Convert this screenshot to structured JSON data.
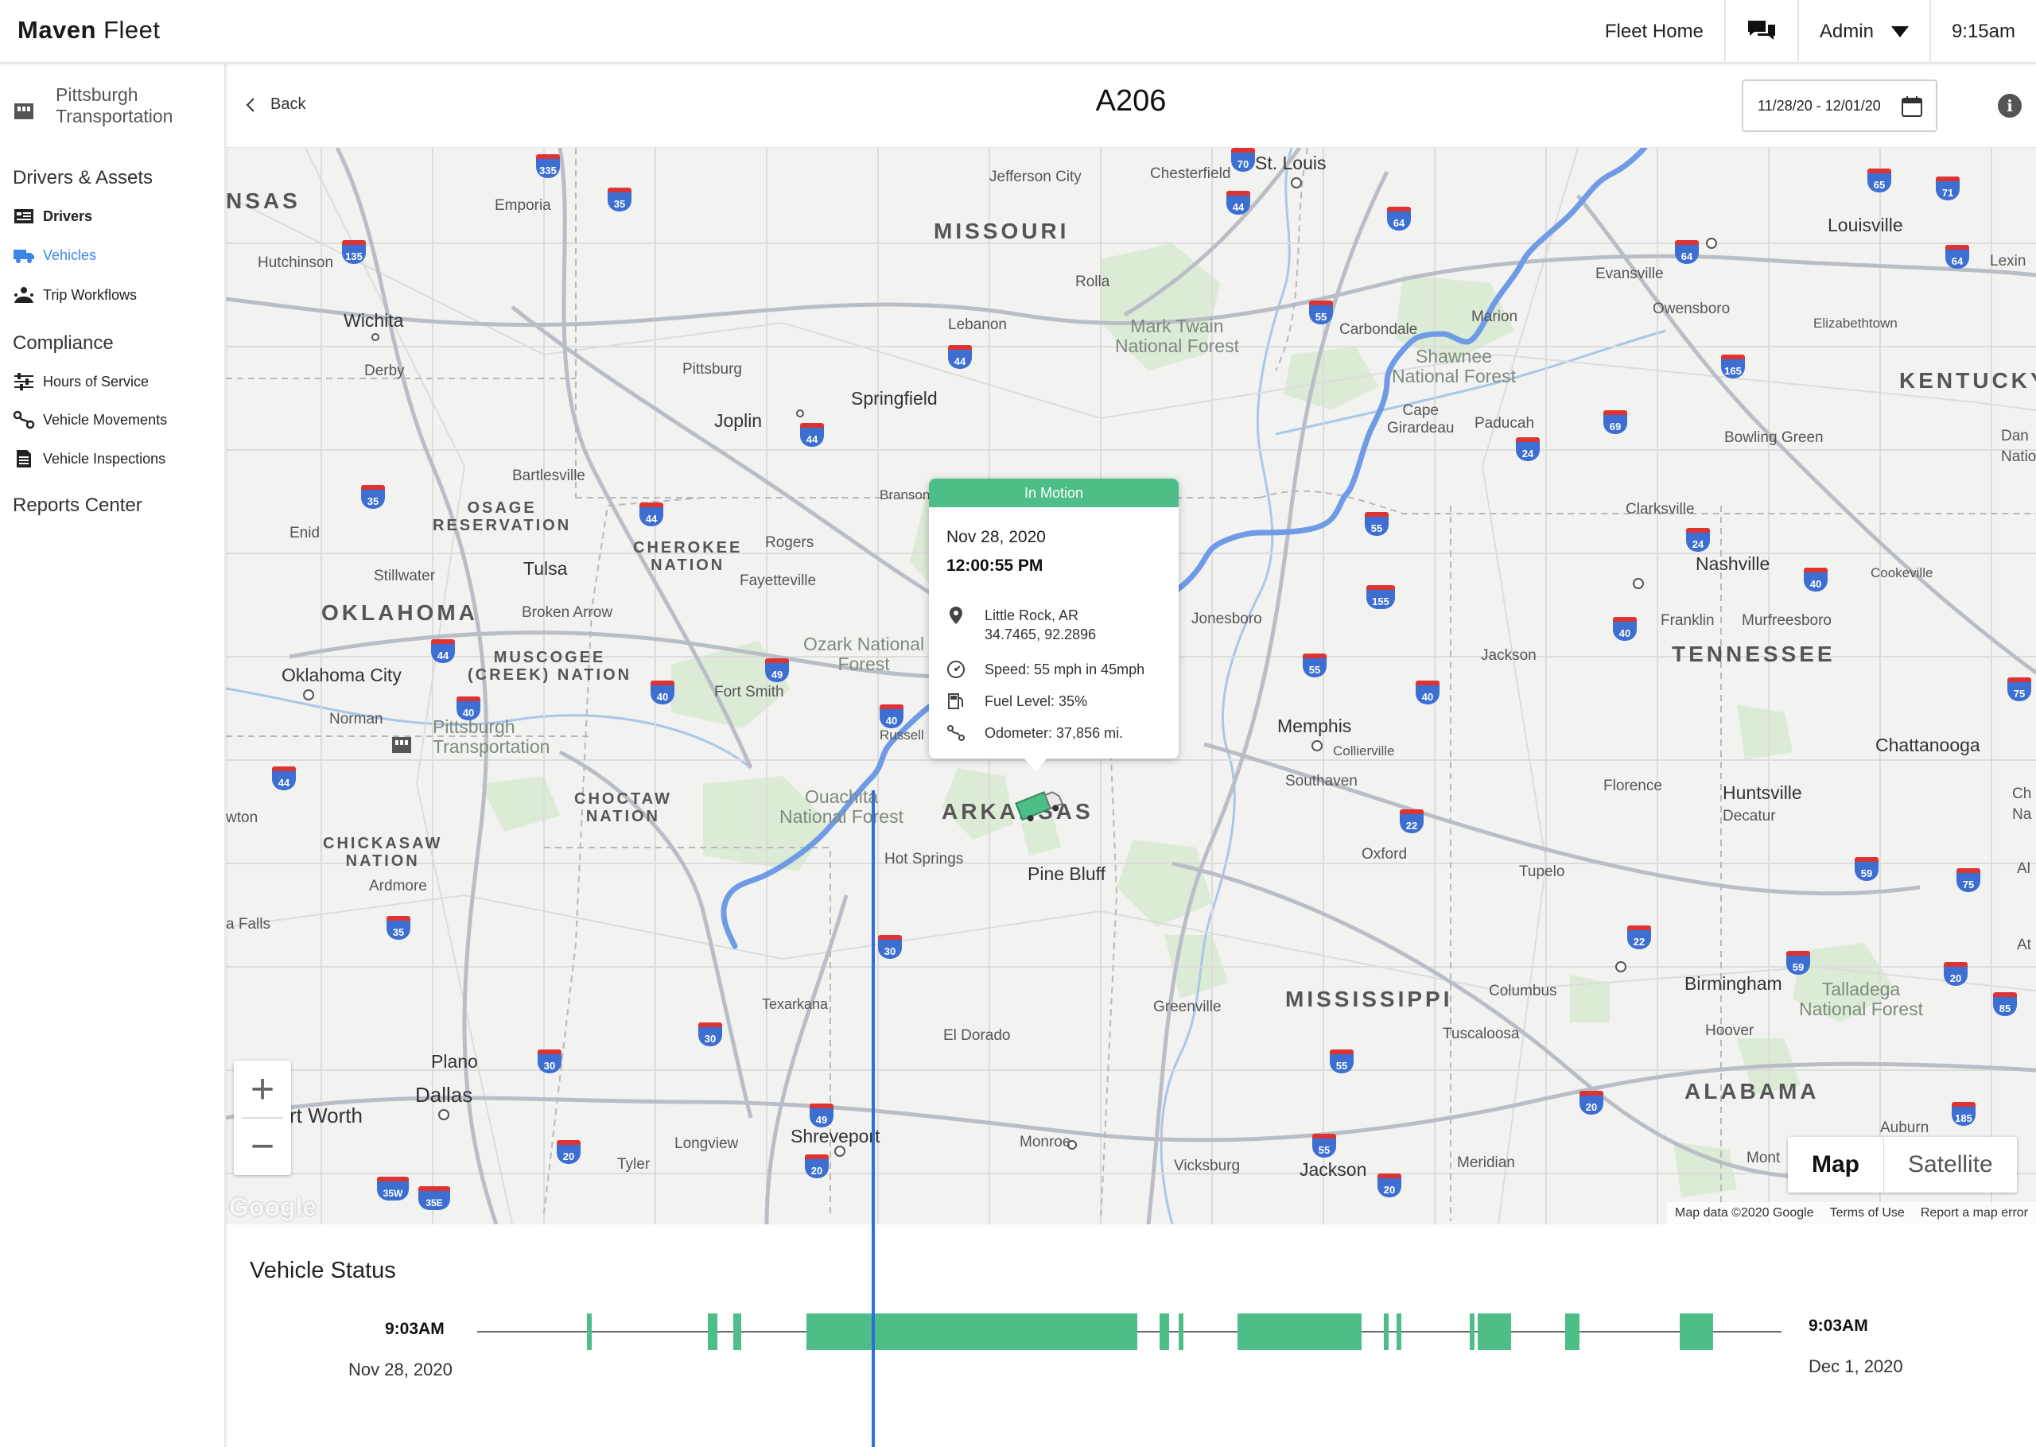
{
  "topbar": {
    "logo_bold": "Maven",
    "logo_rest": "Fleet",
    "fleet_home": "Fleet Home",
    "admin": "Admin",
    "time": "9:15am"
  },
  "sidebar": {
    "org_line1": "Pittsburgh",
    "org_line2": "Transportation",
    "sections": {
      "drivers_assets": "Drivers & Assets",
      "compliance": "Compliance",
      "reports": "Reports Center"
    },
    "items": [
      {
        "label": "Drivers"
      },
      {
        "label": "Vehicles"
      },
      {
        "label": "Trip Workflows"
      },
      {
        "label": "Hours of Service"
      },
      {
        "label": "Vehicle Movements"
      },
      {
        "label": "Vehicle Inspections"
      }
    ],
    "active_color": "#3d86e6"
  },
  "header": {
    "back": "Back",
    "title": "A206",
    "date_range": "11/28/20 - 12/01/20"
  },
  "map": {
    "labels": {
      "st_louis": "St. Louis",
      "jefferson_city": "Jefferson City",
      "chesterfield": "Chesterfield",
      "missouri": "MISSOURI",
      "rolla": "Rolla",
      "louisville": "Louisville",
      "evansville": "Evansville",
      "owensboro": "Owensboro",
      "elizabethtown": "Elizabethtown",
      "lexington": "Lexin",
      "kentucky": "KENTUCKY",
      "nsas": "NSAS",
      "emporia": "Emporia",
      "hutchinson": "Hutchinson",
      "wichita": "Wichita",
      "derby": "Derby",
      "lebanon": "Lebanon",
      "pittsburg": "Pittsburg",
      "springfield": "Springfield",
      "joplin": "Joplin",
      "mark_twain_1": "Mark Twain",
      "mark_twain_2": "National Forest",
      "carbondale": "Carbondale",
      "marion": "Marion",
      "shawnee_1": "Shawnee",
      "shawnee_2": "National Forest",
      "cape_1": "Cape",
      "cape_2": "Girardeau",
      "paducah": "Paducah",
      "bowling_green": "Bowling Green",
      "dan": "Dan",
      "natio": "Natio",
      "bartlesville": "Bartlesville",
      "osage_1": "OSAGE",
      "osage_2": "RESERVATION",
      "enid": "Enid",
      "cherokee_1": "CHEROKEE",
      "cherokee_2": "NATION",
      "rogers": "Rogers",
      "branson": "Branson",
      "clarksville": "Clarksville",
      "stillwater": "Stillwater",
      "tulsa": "Tulsa",
      "fayetteville": "Fayetteville",
      "nashville": "Nashville",
      "cookeville": "Cookeville",
      "oklahoma": "OKLAHOMA",
      "broken_arrow": "Broken Arrow",
      "ozark_1": "Ozark National",
      "ozark_2": "Forest",
      "jonesboro": "Jonesboro",
      "franklin": "Franklin",
      "murfreesboro": "Murfreesboro",
      "muscogee_1": "MUSCOGEE",
      "muscogee_2": "(CREEK) NATION",
      "oklahoma_city": "Oklahoma City",
      "fort_smith": "Fort Smith",
      "jackson_tn": "Jackson",
      "tennessee": "TENNESSEE",
      "norman": "Norman",
      "pitt_1": "Pittsburgh",
      "pitt_2": "Transportation",
      "russellville": "Russell",
      "memphis": "Memphis",
      "collierville": "Collierville",
      "chattanooga": "Chattanooga",
      "southaven": "Southaven",
      "lawton": "wton",
      "choctaw_1": "CHOCTAW",
      "choctaw_2": "NATION",
      "ouachita_1": "Ouachita",
      "ouachita_2": "National Forest",
      "arkansas": "ARKANSAS",
      "florence": "Florence",
      "huntsville": "Huntsville",
      "decatur": "Decatur",
      "ch": "Ch",
      "na": "Na",
      "chickasaw_1": "CHICKASAW",
      "chickasaw_2": "NATION",
      "hot_springs": "Hot Springs",
      "pine_bluff": "Pine Bluff",
      "oxford": "Oxford",
      "tupelo": "Tupelo",
      "ardmore": "Ardmore",
      "al": "Al",
      "falls": "a Falls",
      "at": "At",
      "texarkana": "Texarkana",
      "greenville": "Greenville",
      "mississippi": "MISSISSIPPI",
      "columbus": "Columbus",
      "birmingham": "Birmingham",
      "talladega_1": "Talladega",
      "talladega_2": "National Forest",
      "el_dorado": "El Dorado",
      "tuscaloosa": "Tuscaloosa",
      "hoover": "Hoover",
      "plano": "Plano",
      "dallas": "Dallas",
      "fort_worth": "rt Worth",
      "alabama": "ALABAMA",
      "longview": "Longview",
      "shreveport": "Shreveport",
      "monroe": "Monroe",
      "auburn": "Auburn",
      "tyler": "Tyler",
      "vicksburg": "Vicksburg",
      "jackson_ms": "Jackson",
      "meridian": "Meridian",
      "mont": "Mont"
    },
    "shields": [
      "335",
      "35",
      "135",
      "70",
      "44",
      "64",
      "65",
      "71",
      "64",
      "64",
      "55",
      "165",
      "44",
      "44",
      "24",
      "69",
      "35",
      "44",
      "55",
      "24",
      "40",
      "155",
      "49",
      "44",
      "40",
      "55",
      "40",
      "40",
      "40",
      "75",
      "40",
      "22",
      "44",
      "59",
      "75",
      "35",
      "30",
      "22",
      "59",
      "20",
      "85",
      "30",
      "30",
      "55",
      "20",
      "49",
      "20",
      "185",
      "55",
      "35W",
      "35E",
      "20",
      "20"
    ],
    "popup": {
      "status": "In Motion",
      "date": "Nov 28, 2020",
      "time": "12:00:55 PM",
      "location": "Little Rock, AR",
      "coords": "34.7465, 92.2896",
      "speed": "Speed: 55 mph in 45mph",
      "fuel": "Fuel Level: 35%",
      "odometer": "Odometer: 37,856 mi."
    },
    "map_type": {
      "map": "Map",
      "satellite": "Satellite"
    },
    "google": "Google",
    "attribution": [
      "Map data ©2020 Google",
      "Terms of Use",
      "Report a map error"
    ],
    "route_color": "#6f9be6"
  },
  "status": {
    "title": "Vehicle Status",
    "start_time": "9:03AM",
    "start_date": "Nov 28, 2020",
    "end_time": "9:03AM",
    "end_date": "Dec 1, 2020",
    "segment_color": "#4dbe88",
    "cursor_color": "#2f6fdb"
  }
}
